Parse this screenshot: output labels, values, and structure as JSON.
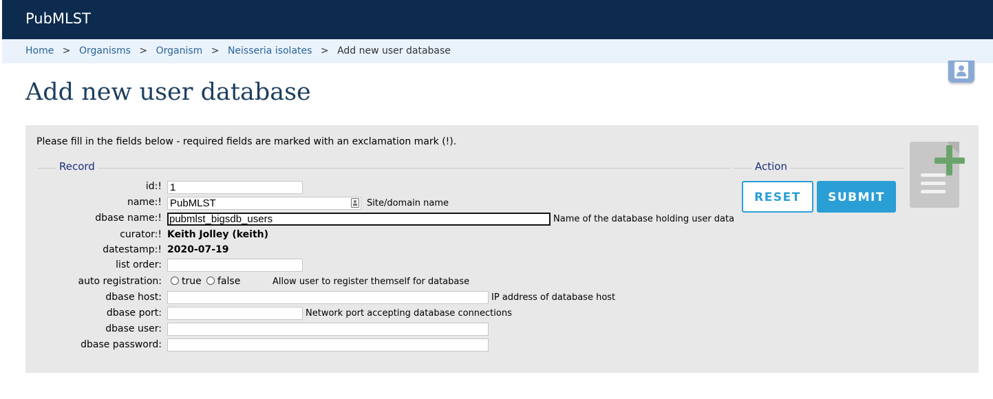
{
  "header": {
    "site_title": "PubMLST"
  },
  "breadcrumb": {
    "items": [
      {
        "label": "Home"
      },
      {
        "label": "Organisms"
      },
      {
        "label": "Organism"
      },
      {
        "label": "Neisseria isolates"
      }
    ],
    "separator": ">",
    "current": "Add new user database"
  },
  "page": {
    "title": "Add new user database"
  },
  "form": {
    "instructions": "Please fill in the fields below - required fields are marked with an exclamation mark (!).",
    "record_legend": "Record",
    "action_legend": "Action",
    "fields": {
      "id": {
        "label": "id:!",
        "value": "1"
      },
      "name": {
        "label": "name:!",
        "value": "PubMLST",
        "hint": "Site/domain name"
      },
      "dbase_name": {
        "label": "dbase name:!",
        "value": "pubmlst_bigsdb_users",
        "hint": "Name of the database holding user data"
      },
      "curator": {
        "label": "curator:!",
        "value": "Keith Jolley (keith)"
      },
      "datestamp": {
        "label": "datestamp:!",
        "value": "2020-07-19"
      },
      "list_order": {
        "label": "list order:",
        "value": ""
      },
      "auto_registration": {
        "label": "auto registration:",
        "options": [
          "true",
          "false"
        ],
        "selected": null,
        "hint": "Allow user to register themself for database"
      },
      "dbase_host": {
        "label": "dbase host:",
        "value": "",
        "hint": "IP address of database host"
      },
      "dbase_port": {
        "label": "dbase port:",
        "value": "",
        "hint": "Network port accepting database connections"
      },
      "dbase_user": {
        "label": "dbase user:",
        "value": ""
      },
      "dbase_password": {
        "label": "dbase password:",
        "value": ""
      }
    },
    "buttons": {
      "reset": "RESET",
      "submit": "SUBMIT"
    }
  },
  "icons": {
    "user": "user-icon",
    "document_add": "document-add-icon",
    "autofill": "contact-card-icon"
  },
  "colors": {
    "header_bg": "#0d2a4f",
    "breadcrumb_bg": "#eaf2fc",
    "link": "#2a6496",
    "title": "#1d3f60",
    "button_accent": "#2a9fd6",
    "panel_bg": "#e8e8e8"
  }
}
